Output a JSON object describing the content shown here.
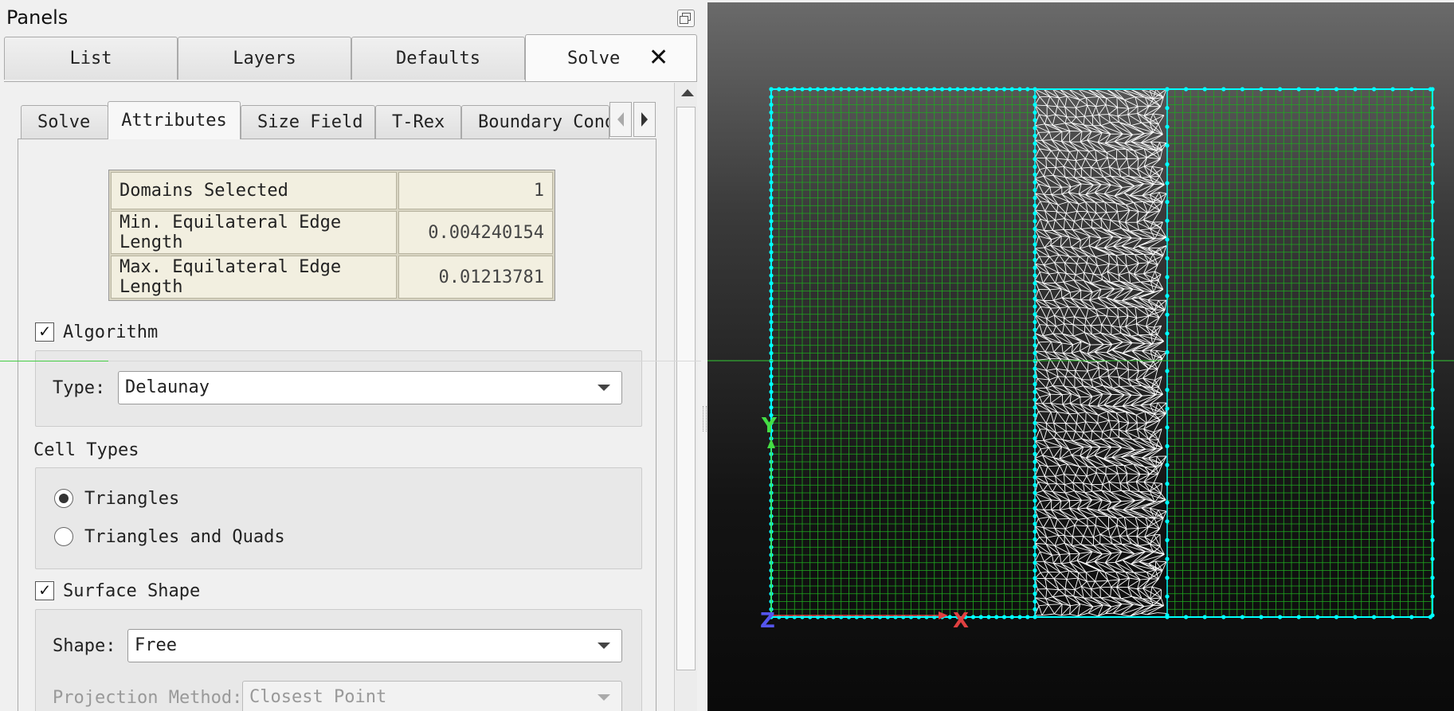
{
  "panel": {
    "title": "Panels"
  },
  "top_tabs": [
    {
      "label": "List"
    },
    {
      "label": "Layers"
    },
    {
      "label": "Defaults"
    },
    {
      "label": "Solve"
    }
  ],
  "sub_tabs": [
    {
      "label": "Solve"
    },
    {
      "label": "Attributes"
    },
    {
      "label": "Size Field"
    },
    {
      "label": "T-Rex"
    },
    {
      "label": "Boundary Condi"
    }
  ],
  "info_table": [
    {
      "label": "Domains Selected",
      "value": "1"
    },
    {
      "label": "Min. Equilateral Edge Length",
      "value": "0.004240154"
    },
    {
      "label": "Max. Equilateral Edge Length",
      "value": "0.01213781"
    }
  ],
  "algorithm": {
    "label": "Algorithm",
    "checked": true,
    "type_label": "Type:",
    "type_value": "Delaunay"
  },
  "cell_types": {
    "heading": "Cell Types",
    "options": [
      {
        "label": "Triangles",
        "selected": true
      },
      {
        "label": "Triangles and Quads",
        "selected": false
      }
    ]
  },
  "surface_shape": {
    "label": "Surface Shape",
    "checked": true,
    "shape_label": "Shape:",
    "shape_value": "Free",
    "projection_label": "Projection Method:",
    "projection_value": "Closest Point"
  },
  "viewport": {
    "axes": {
      "y": "Y",
      "z": "Z",
      "x": "X"
    },
    "colors": {
      "boundary": "#00ffff",
      "structured_grid": "#1faa1f",
      "unstructured": "#ffffff",
      "axis_x": "#e04040",
      "axis_y": "#44dd44",
      "axis_z": "#5555ee"
    }
  },
  "icons": [
    "restore-float-icon",
    "close-tab-icon",
    "scroll-up-icon",
    "tab-left-arrow-icon",
    "tab-right-arrow-icon",
    "checkbox-check-icon",
    "dropdown-caret-icon"
  ]
}
